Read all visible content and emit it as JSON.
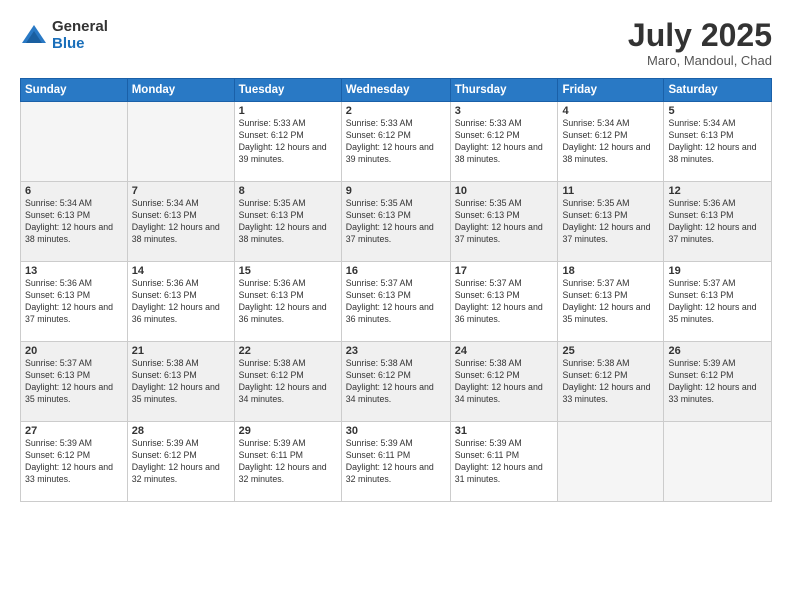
{
  "header": {
    "logo_general": "General",
    "logo_blue": "Blue",
    "title": "July 2025",
    "location": "Maro, Mandoul, Chad"
  },
  "weekdays": [
    "Sunday",
    "Monday",
    "Tuesday",
    "Wednesday",
    "Thursday",
    "Friday",
    "Saturday"
  ],
  "weeks": [
    [
      {
        "day": "",
        "info": ""
      },
      {
        "day": "",
        "info": ""
      },
      {
        "day": "1",
        "info": "Sunrise: 5:33 AM\nSunset: 6:12 PM\nDaylight: 12 hours and 39 minutes."
      },
      {
        "day": "2",
        "info": "Sunrise: 5:33 AM\nSunset: 6:12 PM\nDaylight: 12 hours and 39 minutes."
      },
      {
        "day": "3",
        "info": "Sunrise: 5:33 AM\nSunset: 6:12 PM\nDaylight: 12 hours and 38 minutes."
      },
      {
        "day": "4",
        "info": "Sunrise: 5:34 AM\nSunset: 6:12 PM\nDaylight: 12 hours and 38 minutes."
      },
      {
        "day": "5",
        "info": "Sunrise: 5:34 AM\nSunset: 6:13 PM\nDaylight: 12 hours and 38 minutes."
      }
    ],
    [
      {
        "day": "6",
        "info": "Sunrise: 5:34 AM\nSunset: 6:13 PM\nDaylight: 12 hours and 38 minutes."
      },
      {
        "day": "7",
        "info": "Sunrise: 5:34 AM\nSunset: 6:13 PM\nDaylight: 12 hours and 38 minutes."
      },
      {
        "day": "8",
        "info": "Sunrise: 5:35 AM\nSunset: 6:13 PM\nDaylight: 12 hours and 38 minutes."
      },
      {
        "day": "9",
        "info": "Sunrise: 5:35 AM\nSunset: 6:13 PM\nDaylight: 12 hours and 37 minutes."
      },
      {
        "day": "10",
        "info": "Sunrise: 5:35 AM\nSunset: 6:13 PM\nDaylight: 12 hours and 37 minutes."
      },
      {
        "day": "11",
        "info": "Sunrise: 5:35 AM\nSunset: 6:13 PM\nDaylight: 12 hours and 37 minutes."
      },
      {
        "day": "12",
        "info": "Sunrise: 5:36 AM\nSunset: 6:13 PM\nDaylight: 12 hours and 37 minutes."
      }
    ],
    [
      {
        "day": "13",
        "info": "Sunrise: 5:36 AM\nSunset: 6:13 PM\nDaylight: 12 hours and 37 minutes."
      },
      {
        "day": "14",
        "info": "Sunrise: 5:36 AM\nSunset: 6:13 PM\nDaylight: 12 hours and 36 minutes."
      },
      {
        "day": "15",
        "info": "Sunrise: 5:36 AM\nSunset: 6:13 PM\nDaylight: 12 hours and 36 minutes."
      },
      {
        "day": "16",
        "info": "Sunrise: 5:37 AM\nSunset: 6:13 PM\nDaylight: 12 hours and 36 minutes."
      },
      {
        "day": "17",
        "info": "Sunrise: 5:37 AM\nSunset: 6:13 PM\nDaylight: 12 hours and 36 minutes."
      },
      {
        "day": "18",
        "info": "Sunrise: 5:37 AM\nSunset: 6:13 PM\nDaylight: 12 hours and 35 minutes."
      },
      {
        "day": "19",
        "info": "Sunrise: 5:37 AM\nSunset: 6:13 PM\nDaylight: 12 hours and 35 minutes."
      }
    ],
    [
      {
        "day": "20",
        "info": "Sunrise: 5:37 AM\nSunset: 6:13 PM\nDaylight: 12 hours and 35 minutes."
      },
      {
        "day": "21",
        "info": "Sunrise: 5:38 AM\nSunset: 6:13 PM\nDaylight: 12 hours and 35 minutes."
      },
      {
        "day": "22",
        "info": "Sunrise: 5:38 AM\nSunset: 6:12 PM\nDaylight: 12 hours and 34 minutes."
      },
      {
        "day": "23",
        "info": "Sunrise: 5:38 AM\nSunset: 6:12 PM\nDaylight: 12 hours and 34 minutes."
      },
      {
        "day": "24",
        "info": "Sunrise: 5:38 AM\nSunset: 6:12 PM\nDaylight: 12 hours and 34 minutes."
      },
      {
        "day": "25",
        "info": "Sunrise: 5:38 AM\nSunset: 6:12 PM\nDaylight: 12 hours and 33 minutes."
      },
      {
        "day": "26",
        "info": "Sunrise: 5:39 AM\nSunset: 6:12 PM\nDaylight: 12 hours and 33 minutes."
      }
    ],
    [
      {
        "day": "27",
        "info": "Sunrise: 5:39 AM\nSunset: 6:12 PM\nDaylight: 12 hours and 33 minutes."
      },
      {
        "day": "28",
        "info": "Sunrise: 5:39 AM\nSunset: 6:12 PM\nDaylight: 12 hours and 32 minutes."
      },
      {
        "day": "29",
        "info": "Sunrise: 5:39 AM\nSunset: 6:11 PM\nDaylight: 12 hours and 32 minutes."
      },
      {
        "day": "30",
        "info": "Sunrise: 5:39 AM\nSunset: 6:11 PM\nDaylight: 12 hours and 32 minutes."
      },
      {
        "day": "31",
        "info": "Sunrise: 5:39 AM\nSunset: 6:11 PM\nDaylight: 12 hours and 31 minutes."
      },
      {
        "day": "",
        "info": ""
      },
      {
        "day": "",
        "info": ""
      }
    ]
  ]
}
